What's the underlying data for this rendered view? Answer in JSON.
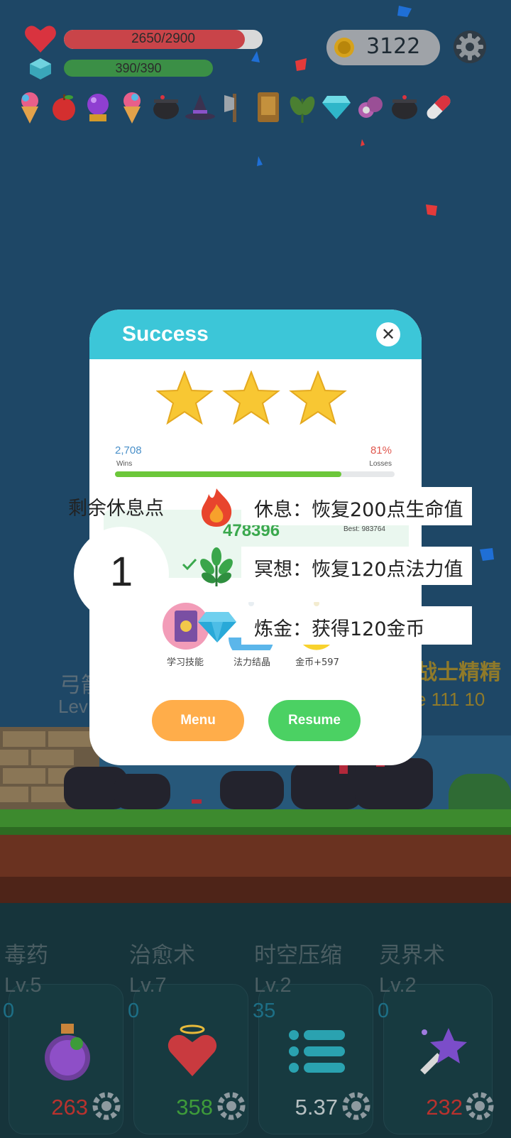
{
  "hud": {
    "hp_text": "2650/2900",
    "hp_fraction": 0.914,
    "mp_text": "390/390",
    "mp_fraction": 1.0,
    "coins": "3122",
    "inventory": [
      "ice-cream-icon",
      "apple-icon",
      "crystal-ball-icon",
      "ice-cream-icon",
      "cauldron-icon",
      "witch-hat-icon",
      "axe-icon",
      "book-icon",
      "herb-icon",
      "diamond-icon",
      "magnifier-icon",
      "cauldron-icon",
      "pill-icon"
    ]
  },
  "background_text": {
    "left_name": "弓箭",
    "left_level": "Lev",
    "right_name": "战士精精",
    "right_level": "e 111 10"
  },
  "dialog": {
    "title": "Success",
    "stars": 3,
    "wins_value": "2,708",
    "wins_label": "Wins",
    "losses_value": "81%",
    "losses_label": "Losses",
    "progress": 0.81,
    "score": "478396",
    "best": "Best: 983764",
    "rewards": [
      {
        "label": "学习技能"
      },
      {
        "label": "法力结晶"
      },
      {
        "label": "金币+597"
      }
    ],
    "menu_button": "Menu",
    "resume_button": "Resume"
  },
  "rest": {
    "points_label": "剩余休息点",
    "points_value": "1",
    "options": [
      {
        "icon": "fire-icon",
        "text": "休息：恢复200点生命值"
      },
      {
        "icon": "leaf-icon",
        "text": "冥想：恢复120点法力值"
      },
      {
        "icon": "diamond-icon",
        "text": "炼金：获得120金币"
      }
    ]
  },
  "skills": [
    {
      "name": "毒药",
      "level": "Lv.5",
      "cooldown": "0",
      "cost": "263",
      "cost_color": "#b8322e"
    },
    {
      "name": "治愈术",
      "level": "Lv.7",
      "cooldown": "0",
      "cost": "358",
      "cost_color": "#3e9b3a"
    },
    {
      "name": "时空压缩",
      "level": "Lv.2",
      "cooldown": "35",
      "cost": "5.37",
      "cost_color": "#b7c0c2"
    },
    {
      "name": "灵界术",
      "level": "Lv.2",
      "cooldown": "0",
      "cost": "232",
      "cost_color": "#b8322e"
    }
  ],
  "colors": {
    "sky": "#1e4766",
    "dialog_header": "#3cc6d8",
    "menu": "#ffad4a",
    "resume": "#4bd163",
    "progress": "#6cc73a"
  }
}
